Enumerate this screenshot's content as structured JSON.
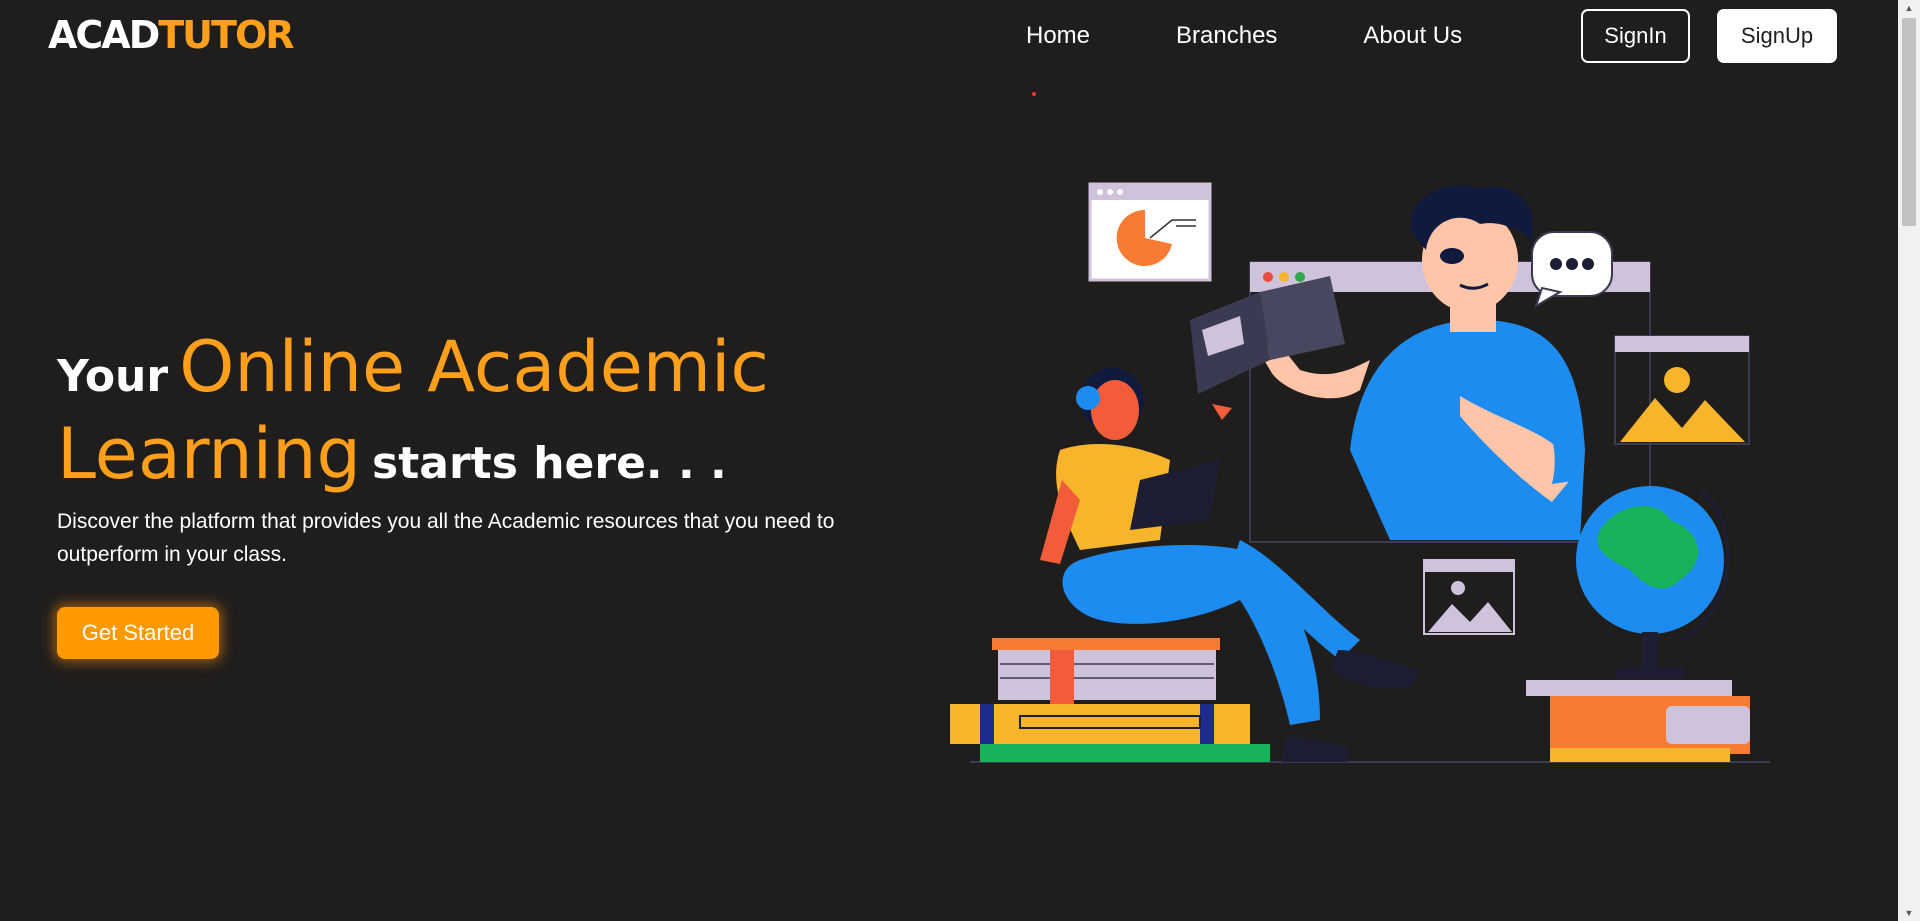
{
  "brand": {
    "part1": "ACAD",
    "part2": "TUTOR",
    "accent": "#ff9f1c"
  },
  "nav": {
    "items": [
      {
        "label": "Home"
      },
      {
        "label": "Branches"
      },
      {
        "label": "About Us"
      }
    ]
  },
  "auth": {
    "signin_label": "SignIn",
    "signup_label": "SignUp"
  },
  "hero": {
    "word_your": "Your",
    "highlight_1": "Online Academic",
    "highlight_2": "Learning",
    "tail": "starts here. . .",
    "description": "Discover the platform that provides you all the Academic resources that you need to outperform in your class.",
    "cta_label": "Get Started"
  },
  "colors": {
    "background": "#201e1d",
    "accent": "#ff9f1c",
    "cta": "#ff9900"
  },
  "icons": [
    "scroll-up-arrow-icon",
    "scroll-down-arrow-icon"
  ]
}
